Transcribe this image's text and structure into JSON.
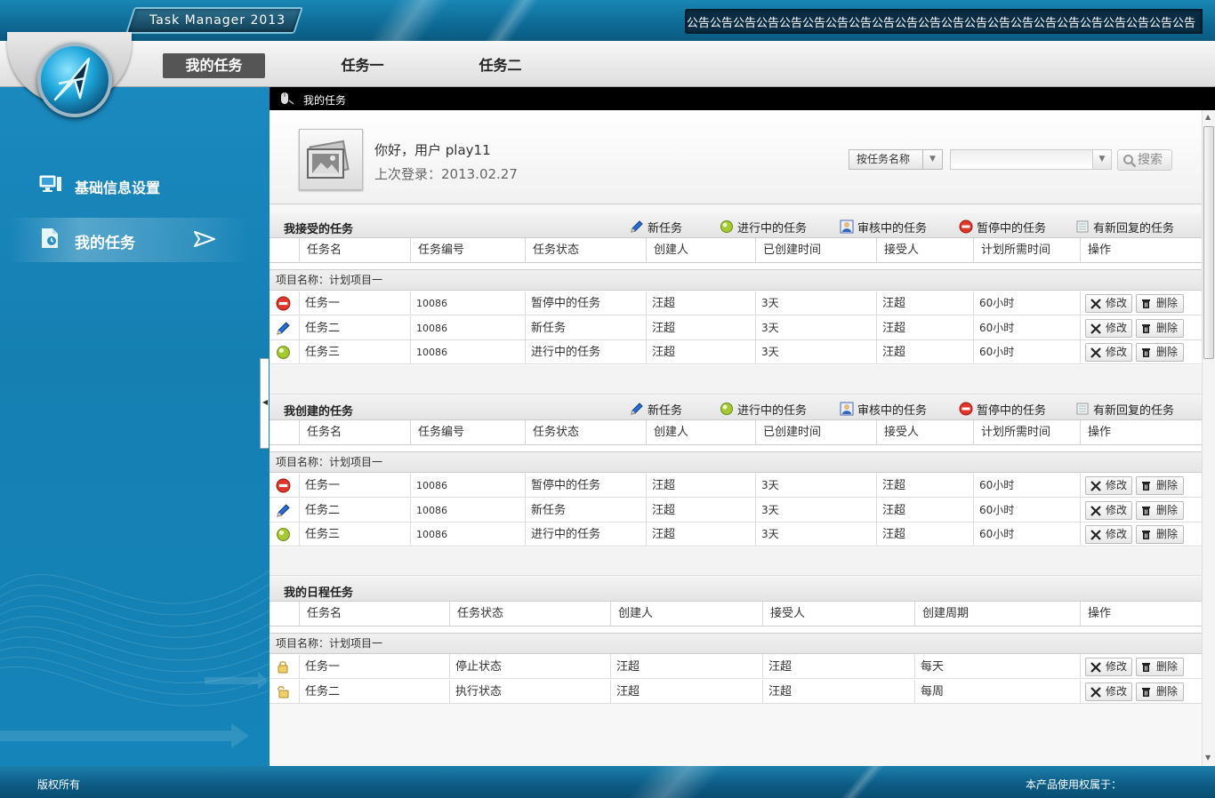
{
  "app": {
    "title": "Task Manager 2013",
    "marquee": "公告公告公告公告公告公告公告公告公告公告公告公告公告公告公告公告公告公告公告公告公告公告"
  },
  "nav": {
    "tabs": [
      {
        "label": "我的任务",
        "active": true
      },
      {
        "label": "任务一",
        "active": false
      },
      {
        "label": "任务二",
        "active": false
      }
    ]
  },
  "sidebar": {
    "items": [
      {
        "label": "基础信息设置",
        "icon": "monitor-icon",
        "active": false
      },
      {
        "label": "我的任务",
        "icon": "task-doc-icon",
        "active": true
      }
    ]
  },
  "breadcrumb": {
    "text": "我的任务"
  },
  "user": {
    "greeting": "你好，用户 play11",
    "last_login": "上次登录：2013.02.27"
  },
  "search": {
    "type_label": "按任务名称",
    "input_value": "",
    "button_label": "搜索"
  },
  "legend": {
    "new": "新任务",
    "in_progress": "进行中的任务",
    "reviewing": "审核中的任务",
    "paused": "暂停中的任务",
    "new_reply": "有新回复的任务"
  },
  "actions": {
    "edit": "修改",
    "delete": "删除"
  },
  "received": {
    "title": "我接受的任务",
    "columns": [
      "任务名",
      "任务编号",
      "任务状态",
      "创建人",
      "已创建时间",
      "接受人",
      "计划所需时间",
      "操作"
    ],
    "project": "项目名称：计划项目一",
    "rows": [
      {
        "status_icon": "paused-icon",
        "name": "任务一",
        "id": "10086",
        "status": "暂停中的任务",
        "creator": "汪超",
        "age": "3天",
        "assignee": "汪超",
        "planned": "60小时"
      },
      {
        "status_icon": "pencil-icon",
        "name": "任务二",
        "id": "10086",
        "status": "新任务",
        "creator": "汪超",
        "age": "3天",
        "assignee": "汪超",
        "planned": "60小时"
      },
      {
        "status_icon": "progress-icon",
        "name": "任务三",
        "id": "10086",
        "status": "进行中的任务",
        "creator": "汪超",
        "age": "3天",
        "assignee": "汪超",
        "planned": "60小时"
      }
    ]
  },
  "created": {
    "title": "我创建的任务",
    "columns": [
      "任务名",
      "任务编号",
      "任务状态",
      "创建人",
      "已创建时间",
      "接受人",
      "计划所需时间",
      "操作"
    ],
    "project": "项目名称：计划项目一",
    "rows": [
      {
        "status_icon": "paused-icon",
        "name": "任务一",
        "id": "10086",
        "status": "暂停中的任务",
        "creator": "汪超",
        "age": "3天",
        "assignee": "汪超",
        "planned": "60小时"
      },
      {
        "status_icon": "pencil-icon",
        "name": "任务二",
        "id": "10086",
        "status": "新任务",
        "creator": "汪超",
        "age": "3天",
        "assignee": "汪超",
        "planned": "60小时"
      },
      {
        "status_icon": "progress-icon",
        "name": "任务三",
        "id": "10086",
        "status": "进行中的任务",
        "creator": "汪超",
        "age": "3天",
        "assignee": "汪超",
        "planned": "60小时"
      }
    ]
  },
  "schedule": {
    "title": "我的日程任务",
    "columns": [
      "任务名",
      "任务状态",
      "创建人",
      "接受人",
      "创建周期",
      "操作"
    ],
    "project": "项目名称：计划项目一",
    "rows": [
      {
        "status_icon": "lock-icon",
        "name": "任务一",
        "status": "停止状态",
        "creator": "汪超",
        "assignee": "汪超",
        "cycle": "每天"
      },
      {
        "status_icon": "unlock-icon",
        "name": "任务二",
        "status": "执行状态",
        "creator": "汪超",
        "assignee": "汪超",
        "cycle": "每周"
      }
    ]
  },
  "footer": {
    "copyright": "版权所有",
    "license": "本产品使用权属于："
  }
}
